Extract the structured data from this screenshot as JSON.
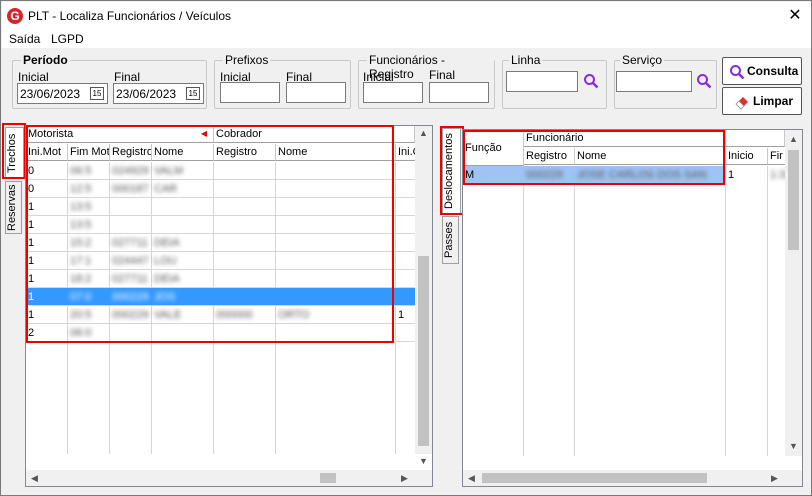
{
  "window": {
    "title": "PLT - Localiza Funcionários / Veículos",
    "close_glyph": "✕",
    "app_icon": "G"
  },
  "menu": [
    "Saída",
    "LGPD"
  ],
  "periodo": {
    "title": "Período",
    "inicial_label": "Inicial",
    "final_label": "Final",
    "inicial_value": "23/06/2023",
    "final_value": "23/06/2023",
    "calendar_glyph": "15"
  },
  "prefixos": {
    "title": "Prefixos",
    "inicial_label": "Inicial",
    "final_label": "Final"
  },
  "funcionarios": {
    "title": "Funcionários - Registro",
    "inicial_label": "Inicial",
    "final_label": "Final"
  },
  "linha": {
    "title": "Linha"
  },
  "servico": {
    "title": "Serviço"
  },
  "buttons": {
    "consulta": "Consulta",
    "limpar": "Limpar"
  },
  "left_tabs": [
    "Trechos",
    "Reservas"
  ],
  "right_tabs": [
    "Deslocamentos",
    "Passes"
  ],
  "left_grid": {
    "group_headers": [
      "Motorista",
      "Cobrador"
    ],
    "columns": [
      "Ini.Mot",
      "Fim Mot",
      "Registro",
      "Nome",
      "Registro",
      "Nome",
      "Ini.C"
    ],
    "rows": [
      [
        "0",
        "06:5",
        "024929",
        "VALM",
        "",
        "",
        ""
      ],
      [
        "0",
        "12:5",
        "000187",
        "CAR",
        "",
        "",
        ""
      ],
      [
        "1",
        "13:5",
        "",
        "",
        "",
        "",
        ""
      ],
      [
        "1",
        "13:5",
        "",
        "",
        "",
        "",
        ""
      ],
      [
        "1",
        "15:2",
        "027711",
        "DEIA",
        "",
        "",
        ""
      ],
      [
        "1",
        "17:1",
        "024447",
        "LOU",
        "",
        "",
        ""
      ],
      [
        "1",
        "18:2",
        "027711",
        "DEIA",
        "",
        "",
        ""
      ],
      [
        "1",
        "07:0",
        "000229",
        "JOS",
        "",
        "",
        ""
      ],
      [
        "1",
        "20:5",
        "000229",
        "VALE",
        "000000",
        "ORTO",
        "1"
      ],
      [
        "2",
        "06:0",
        "",
        "",
        "",
        "",
        ""
      ]
    ],
    "selected_row": 7,
    "accent_color": "#3399ff"
  },
  "right_grid": {
    "group_header": "Funcionário",
    "columns": [
      "Função",
      "Registro",
      "Nome",
      "Inicio",
      "Fir"
    ],
    "rows": [
      [
        "M",
        "000229",
        "JOSE CARLOS DOS SAN",
        "1",
        "1:32"
      ]
    ]
  }
}
